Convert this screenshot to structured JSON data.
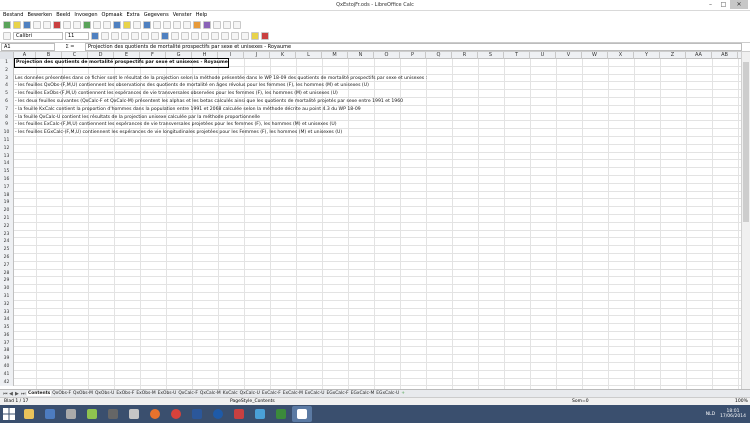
{
  "window": {
    "title": "QxEstojFr.ods - LibreOffice Calc"
  },
  "menu": [
    "Bestand",
    "Bewerken",
    "Beeld",
    "Invoegen",
    "Opmaak",
    "Extra",
    "Gegevens",
    "Venster",
    "Help"
  ],
  "toolbar": {
    "font_name": "Calibri",
    "font_size": "11"
  },
  "formula": {
    "cell_ref": "A1",
    "fx": "Σ =",
    "content": "Projection des quotients de mortalité prospectifs par sexe et unisexes - Royaume"
  },
  "columns": [
    "A",
    "B",
    "C",
    "D",
    "E",
    "F",
    "G",
    "H",
    "I",
    "J",
    "K",
    "L",
    "M",
    "N",
    "O",
    "P",
    "Q",
    "R",
    "S",
    "T",
    "U",
    "V",
    "W",
    "X",
    "Y",
    "Z",
    "AA",
    "AB"
  ],
  "rows": [
    {
      "n": "1",
      "text": "Projection des quotients de mortalité prospectifs par sexe et unisexes - Royaume",
      "bold": true
    },
    {
      "n": "2",
      "text": ""
    },
    {
      "n": "3",
      "text": "Les données présentées dans ce fichier sont le résultat de la projection selon la méthode présentée dans le WP 18-09 des quotients de mortalité prospectifs par sexe et unisexes :"
    },
    {
      "n": "4",
      "text": "- les feuilles QxObs-(F,M,U) contiennent les observations des quotients de mortalité en âges révolus pour les femmes (F), les hommes (M) et unisexes (U)"
    },
    {
      "n": "5",
      "text": "- les feuilles ExObs-(F,M,U) contiennent les espérances de vie transversales observées pour les femmes (F), les hommes (M) et unisexes (U)"
    },
    {
      "n": "6",
      "text": "- les deux feuilles suivantes (QxCalc-F et QxCalc-M) présentent les alphas et les betas calculés ainsi que les quotients de mortalité projetés par sexe entre 1991 et 1960"
    },
    {
      "n": "7",
      "text": "- la feuille KxCalc contient la proportion d'hommes dans la population entre 1991 et 2068 calculée selon la méthode décrite au point 4.3 du WP 18-09"
    },
    {
      "n": "8",
      "text": "- la feuille QxCalc-U contient les résultats de la projection unisexe calculée par la méthode proportionnelle"
    },
    {
      "n": "9",
      "text": "- les feuilles ExCalc-(F,M,U) contiennent les espérances de vie transversales projetées pour les femmes (F), les hommes (M) et unisexes (U)"
    },
    {
      "n": "10",
      "text": "- les feuilles EGxCalc-(F,M,U) contiennent les espérances de vie longitudinales projetées pour les Femmes (F), les hommes (M) et unisexes (U)"
    },
    {
      "n": "11",
      "text": ""
    },
    {
      "n": "12",
      "text": ""
    },
    {
      "n": "13",
      "text": ""
    },
    {
      "n": "14",
      "text": ""
    },
    {
      "n": "15",
      "text": ""
    },
    {
      "n": "16",
      "text": ""
    },
    {
      "n": "17",
      "text": ""
    },
    {
      "n": "18",
      "text": ""
    },
    {
      "n": "19",
      "text": ""
    },
    {
      "n": "20",
      "text": ""
    },
    {
      "n": "21",
      "text": ""
    },
    {
      "n": "22",
      "text": ""
    },
    {
      "n": "23",
      "text": ""
    },
    {
      "n": "24",
      "text": ""
    },
    {
      "n": "25",
      "text": ""
    },
    {
      "n": "26",
      "text": ""
    },
    {
      "n": "27",
      "text": ""
    },
    {
      "n": "28",
      "text": ""
    },
    {
      "n": "29",
      "text": ""
    },
    {
      "n": "30",
      "text": ""
    },
    {
      "n": "31",
      "text": ""
    },
    {
      "n": "32",
      "text": ""
    },
    {
      "n": "33",
      "text": ""
    },
    {
      "n": "34",
      "text": ""
    },
    {
      "n": "35",
      "text": ""
    },
    {
      "n": "36",
      "text": ""
    },
    {
      "n": "37",
      "text": ""
    },
    {
      "n": "38",
      "text": ""
    },
    {
      "n": "39",
      "text": ""
    },
    {
      "n": "40",
      "text": ""
    },
    {
      "n": "41",
      "text": ""
    },
    {
      "n": "42",
      "text": ""
    }
  ],
  "tabs": [
    "Contents",
    "QxObs-F",
    "QxObs-M",
    "QxObs-U",
    "ExObs-F",
    "ExObs-M",
    "ExObs-U",
    "QxCalc-F",
    "QxCalc-M",
    "KxCalc",
    "QxCalc-U",
    "ExCalc-F",
    "ExCalc-M",
    "ExCalc-U",
    "EGxCalc-F",
    "EGxCalc-M",
    "EGxCalc-U"
  ],
  "status": {
    "sheet": "Blad 1 / 17",
    "style": "PageStyle_Contents",
    "sum": "Som=0",
    "zoom": "100%"
  },
  "taskbar": {
    "lang": "NLD",
    "time": "18:01",
    "date": "17/06/2014"
  }
}
